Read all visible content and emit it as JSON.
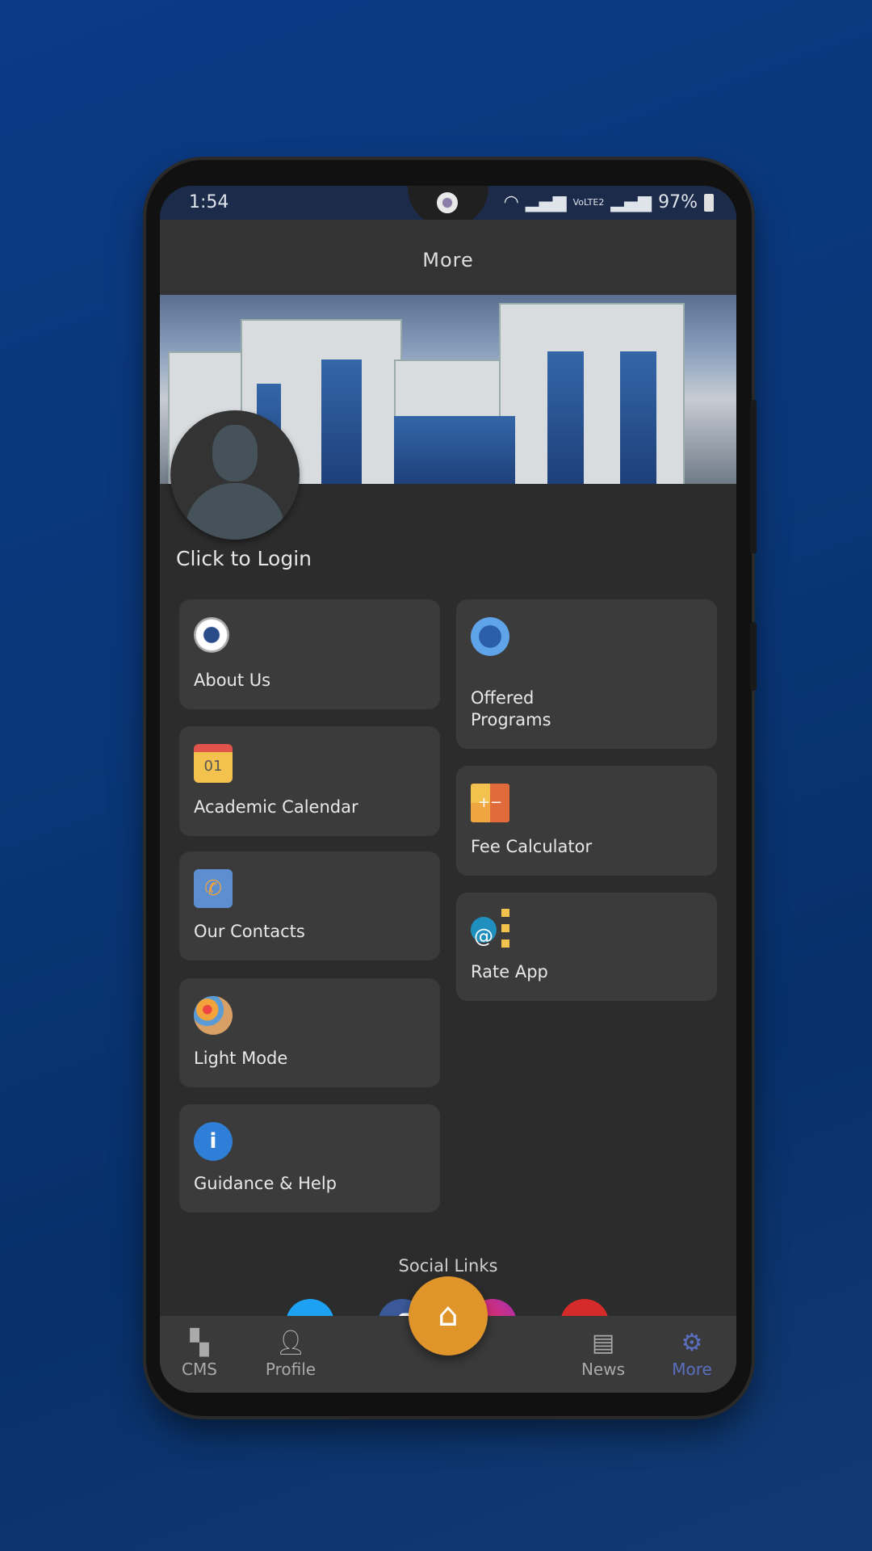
{
  "status": {
    "time": "1:54",
    "network": "VoLTE2",
    "battery": "97%"
  },
  "header": {
    "title": "More"
  },
  "profile": {
    "login_label": "Click to Login"
  },
  "menu": {
    "left": [
      {
        "label": "About Us",
        "icon": "university-seal-icon"
      },
      {
        "label": "Academic Calendar",
        "icon": "calendar-icon",
        "icon_text": "01"
      },
      {
        "label": "Our Contacts",
        "icon": "contact-book-icon"
      },
      {
        "label": "Light Mode",
        "icon": "palette-icon"
      },
      {
        "label": "Guidance & Help",
        "icon": "info-icon"
      }
    ],
    "right": [
      {
        "label": "Offered\nPrograms",
        "icon": "book-icon"
      },
      {
        "label": "Fee Calculator",
        "icon": "calculator-icon"
      },
      {
        "label": "Rate App",
        "icon": "rate-icon"
      }
    ]
  },
  "social": {
    "title": "Social Links",
    "links": [
      "twitter",
      "facebook",
      "instagram",
      "youtube"
    ]
  },
  "nav": {
    "items": [
      {
        "label": "CMS"
      },
      {
        "label": "Profile"
      },
      {
        "label": "News"
      },
      {
        "label": "More",
        "active": true
      }
    ],
    "active_color": "#5a6fc0",
    "fab_color": "#e0952a"
  }
}
